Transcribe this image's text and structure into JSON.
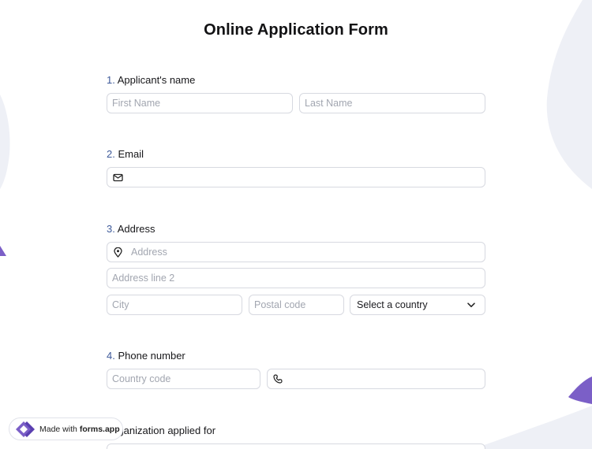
{
  "title": "Online Application Form",
  "questions": {
    "q1": {
      "num": "1.",
      "label": "Applicant's name"
    },
    "q2": {
      "num": "2.",
      "label": "Email"
    },
    "q3": {
      "num": "3.",
      "label": "Address"
    },
    "q4": {
      "num": "4.",
      "label": "Phone number"
    },
    "q5": {
      "label": "Organization applied for"
    }
  },
  "fields": {
    "first_name": "First Name",
    "last_name": "Last Name",
    "email": "",
    "address": "Address",
    "address2": "Address line 2",
    "city": "City",
    "postal": "Postal code",
    "country": "Select a country",
    "country_code": "Country code",
    "phone": ""
  },
  "badge": {
    "prefix": "Made with",
    "brand": "forms.app"
  },
  "icons": {
    "email": "mail-icon",
    "address": "map-pin-icon",
    "phone": "phone-icon",
    "dropdown": "chevron-down-icon",
    "brand": "forms-app-logo-icon"
  },
  "colors": {
    "accent": "#7b5fc7",
    "number": "#3e5a9a",
    "border": "#d7d9e0",
    "bg_shape": "#eef0f6"
  }
}
